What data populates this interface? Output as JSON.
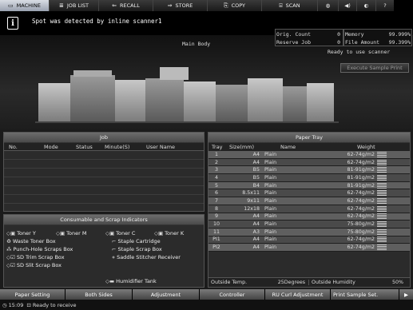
{
  "nav": {
    "tabs": [
      {
        "label": "MACHINE",
        "icon": "machine-icon"
      },
      {
        "label": "JOB LIST",
        "icon": "list-icon"
      },
      {
        "label": "RECALL",
        "icon": "recall-icon"
      },
      {
        "label": "STORE",
        "icon": "store-icon"
      },
      {
        "label": "COPY",
        "icon": "copy-icon"
      },
      {
        "label": "SCAN",
        "icon": "scan-icon"
      }
    ]
  },
  "message": {
    "text": "Spot was detected by inline scanner1"
  },
  "status": {
    "main_body_label": "Main Body",
    "orig_count_label": "Orig. Count",
    "orig_count_value": "0",
    "reserve_job_label": "Reserve Job",
    "reserve_job_value": "0",
    "memory_label": "Memory",
    "memory_value": "99.999%",
    "file_amount_label": "File Amount",
    "file_amount_value": "99.399%",
    "ready_text": "Ready to use scanner",
    "exec_sample_label": "Execute Sample Print"
  },
  "job_panel": {
    "title": "Job",
    "columns": [
      "No.",
      "Mode",
      "Status",
      "Minute(S)",
      "User Name"
    ]
  },
  "consumables": {
    "title": "Consumable and Scrap Indicators",
    "items": [
      "Toner Y",
      "Toner M",
      "Toner C",
      "Toner K",
      "Waste Toner Box",
      "Staple Cartridge",
      "Punch-Hole Scraps Box",
      "Staple Scrap Box",
      "SD Trim Scrap Box",
      "Saddle Stitcher Receiver",
      "SD Slit Scrap Box",
      "Humidifier Tank"
    ]
  },
  "paper_tray": {
    "title": "Paper Tray",
    "columns": [
      "Tray",
      "Size(mm)",
      "Name",
      "Weight"
    ],
    "rows": [
      {
        "tray": "1",
        "size": "A4",
        "name": "Plain",
        "weight": "62-74g/m2"
      },
      {
        "tray": "2",
        "size": "A4",
        "name": "Plain",
        "weight": "62-74g/m2"
      },
      {
        "tray": "3",
        "size": "B5",
        "name": "Plain",
        "weight": "81-91g/m2"
      },
      {
        "tray": "4",
        "size": "B5",
        "name": "Plain",
        "weight": "81-91g/m2"
      },
      {
        "tray": "5",
        "size": "B4",
        "name": "Plain",
        "weight": "81-91g/m2"
      },
      {
        "tray": "6",
        "size": "8.5x11",
        "name": "Plain",
        "weight": "62-74g/m2"
      },
      {
        "tray": "7",
        "size": "9x11",
        "name": "Plain",
        "weight": "62-74g/m2"
      },
      {
        "tray": "8",
        "size": "12x18",
        "name": "Plain",
        "weight": "62-74g/m2"
      },
      {
        "tray": "9",
        "size": "A4",
        "name": "Plain",
        "weight": "62-74g/m2"
      },
      {
        "tray": "10",
        "size": "A4",
        "name": "Plain",
        "weight": "75-80g/m2"
      },
      {
        "tray": "11",
        "size": "A3",
        "name": "Plain",
        "weight": "75-80g/m2"
      },
      {
        "tray": "PI1",
        "size": "A4",
        "name": "Plain",
        "weight": "62-74g/m2"
      },
      {
        "tray": "PI2",
        "size": "A4",
        "name": "Plain",
        "weight": "62-74g/m2"
      }
    ],
    "outside_temp_label": "Outside Temp.",
    "outside_temp_value": "25Degrees",
    "outside_humidity_label": "Outside Humidity",
    "outside_humidity_value": "50%"
  },
  "bottom_buttons": [
    "Paper Setting",
    "Both Sides",
    "Adjustment",
    "Controller",
    "RU Curl Adjustment",
    "Print Sample Set."
  ],
  "footer": {
    "time": "15:09",
    "status": "Ready to receive"
  },
  "colors": {
    "accent": "#9aa2b0",
    "panel_title": "#5a5a5a",
    "tray_row": "#5f5f5f"
  }
}
